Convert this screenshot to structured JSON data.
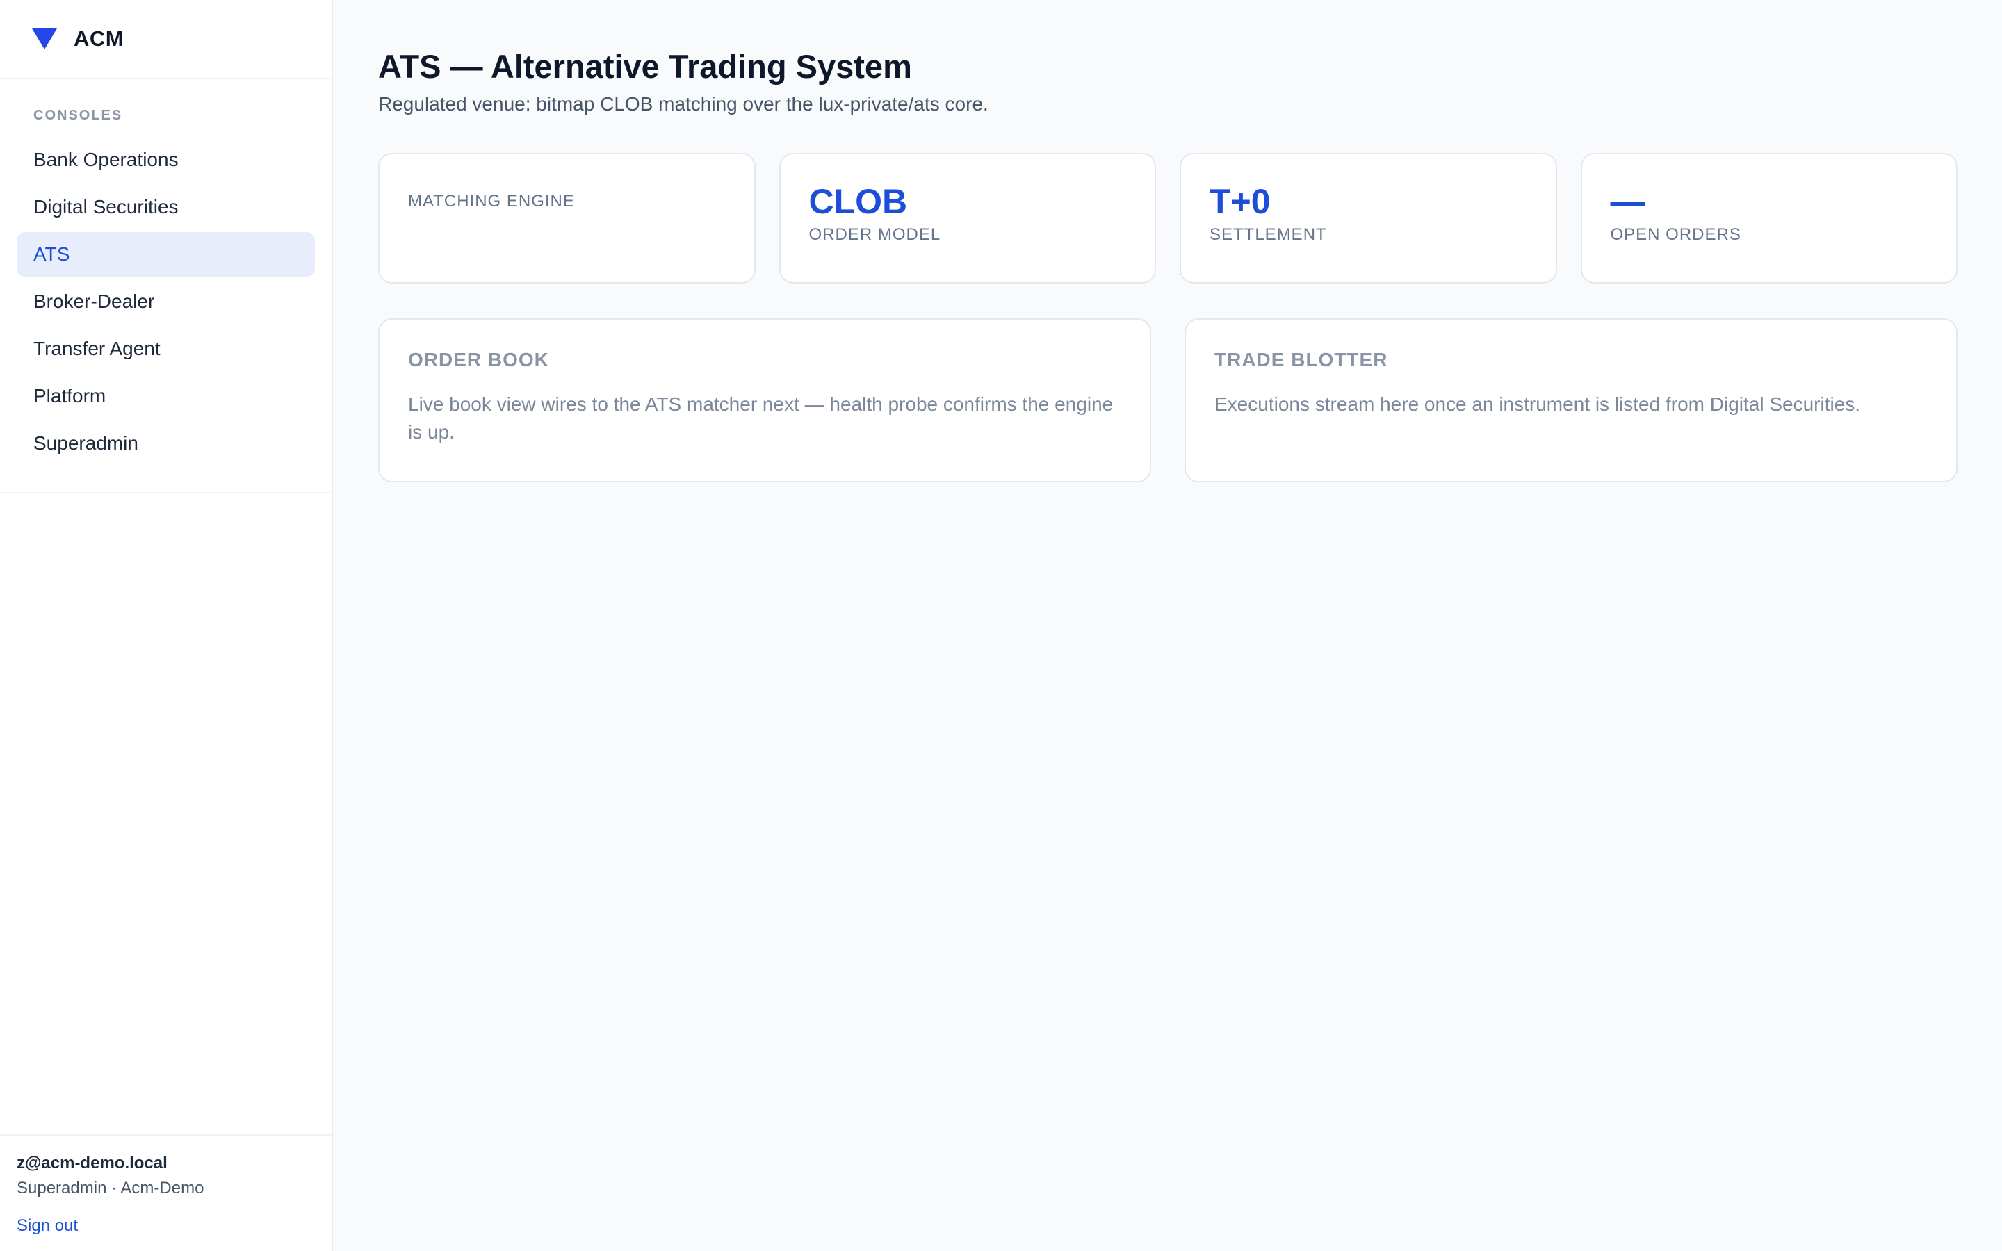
{
  "brand": {
    "name": "ACM",
    "logo_icon": "triangle-down-icon",
    "accent_color": "#2547e8"
  },
  "sidebar": {
    "section_heading": "CONSOLES",
    "items": [
      {
        "label": "Bank Operations",
        "active": false
      },
      {
        "label": "Digital Securities",
        "active": false
      },
      {
        "label": "ATS",
        "active": true
      },
      {
        "label": "Broker-Dealer",
        "active": false
      },
      {
        "label": "Transfer Agent",
        "active": false
      },
      {
        "label": "Platform",
        "active": false
      },
      {
        "label": "Superadmin",
        "active": false
      }
    ]
  },
  "user": {
    "email": "z@acm-demo.local",
    "role_line": "Superadmin · Acm-Demo",
    "signout_label": "Sign out"
  },
  "page": {
    "title": "ATS — Alternative Trading System",
    "subtitle": "Regulated venue: bitmap CLOB matching over the lux-private/ats core."
  },
  "stats": [
    {
      "value": "",
      "label": "MATCHING ENGINE"
    },
    {
      "value": "CLOB",
      "label": "ORDER MODEL"
    },
    {
      "value": "T+0",
      "label": "SETTLEMENT"
    },
    {
      "value": "—",
      "label": "OPEN ORDERS"
    }
  ],
  "panels": [
    {
      "title": "ORDER BOOK",
      "text": "Live book view wires to the ATS matcher next — health probe confirms the engine is up."
    },
    {
      "title": "TRADE BLOTTER",
      "text": "Executions stream here once an instrument is listed from Digital Securities."
    }
  ]
}
